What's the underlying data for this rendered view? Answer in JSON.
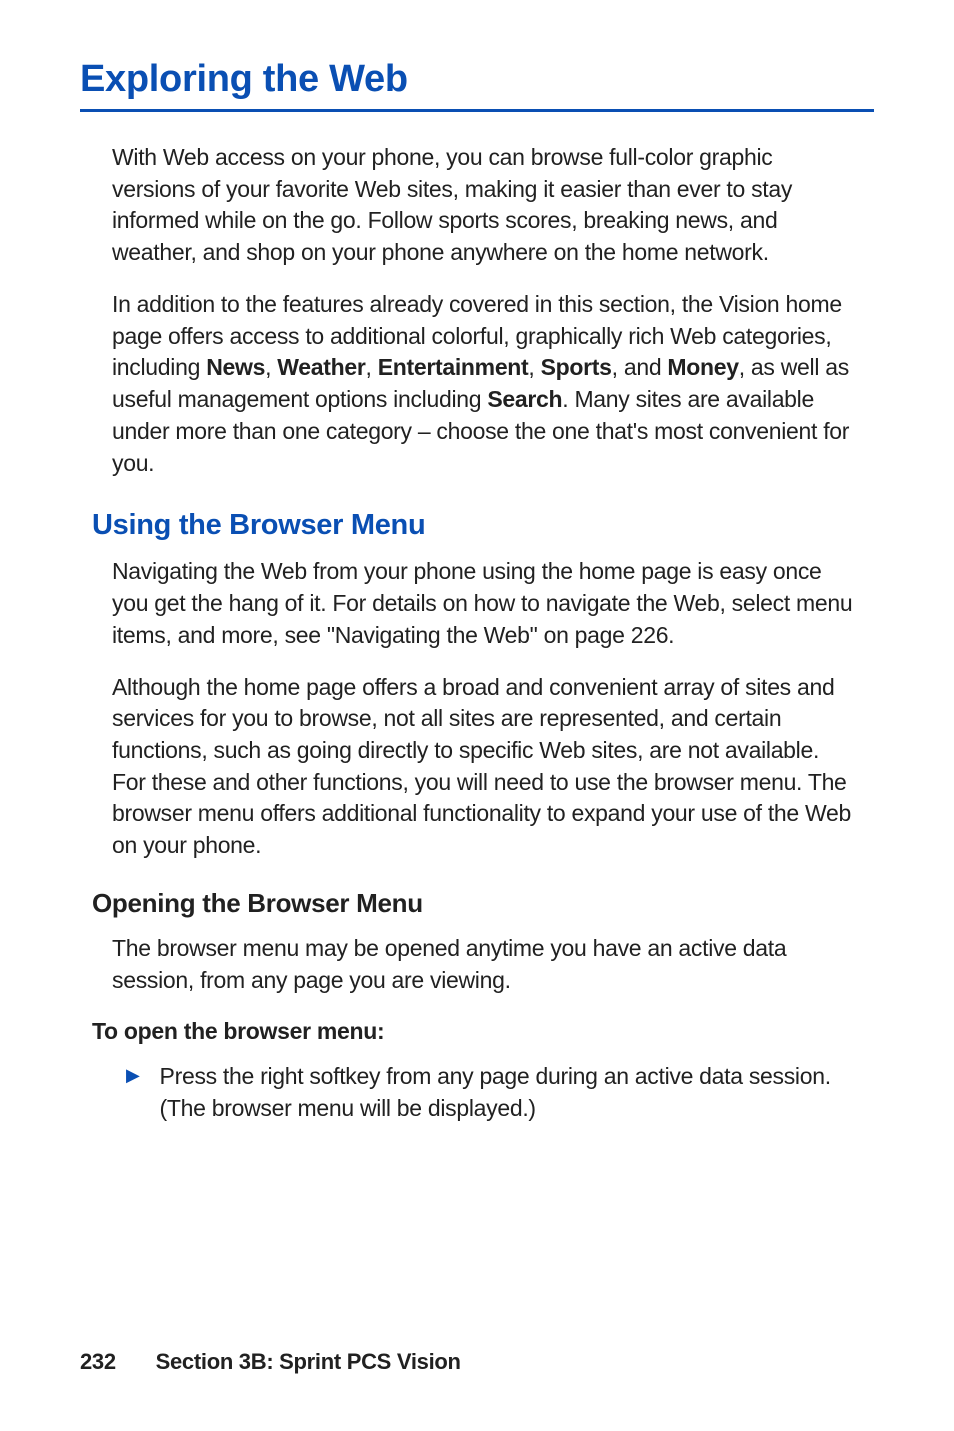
{
  "title": "Exploring the Web",
  "para1": "With Web access on your phone, you can browse full-color graphic versions of your favorite Web sites, making it easier than ever to stay informed while on the go. Follow sports scores, breaking news, and weather, and shop on your phone anywhere on the home network.",
  "para2_pre": "In addition to the features already covered in this section, the Vision home page offers access to additional colorful, graphically rich Web categories, including ",
  "para2_b1": "News",
  "para2_s1": ", ",
  "para2_b2": "Weather",
  "para2_s2": ", ",
  "para2_b3": "Entertainment",
  "para2_s3": ", ",
  "para2_b4": "Sports",
  "para2_s4": ", and ",
  "para2_b5": "Money",
  "para2_s5": ", as well as useful management options including ",
  "para2_b6": "Search",
  "para2_post": ". Many sites are available under more than one category – choose the one that's most convenient for you.",
  "h2": "Using the Browser Menu",
  "para3": "Navigating the Web from your phone using the home page is easy once you get the hang of it. For details on how to navigate the Web, select menu items, and more, see \"Navigating the Web\" on page 226.",
  "para4": "Although the home page offers a broad and convenient array of sites and services for you to browse, not all sites are represented, and certain functions, such as going directly to specific Web sites, are not available. For these and other functions, you will need to use the browser menu. The browser menu offers additional functionality to expand your use of the Web on your phone.",
  "h3": "Opening the Browser Menu",
  "para5": "The browser menu may be opened anytime you have an active data session, from any page you are viewing.",
  "h4": "To open the browser menu:",
  "bullet1": "Press the right softkey from any page during an active data session. (The browser menu will be displayed.)",
  "footer_page": "232",
  "footer_section": "Section 3B: Sprint PCS Vision"
}
